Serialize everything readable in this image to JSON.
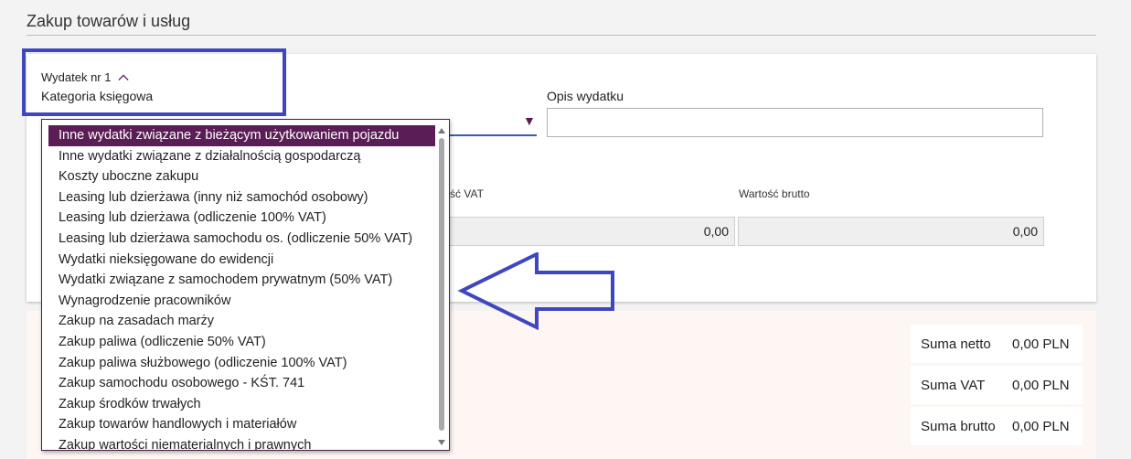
{
  "page": {
    "title": "Zakup towarów i usług"
  },
  "expense": {
    "header": "Wydatek nr 1",
    "category_label": "Kategoria księgowa",
    "description_label": "Opis wydatku",
    "description_value": ""
  },
  "amounts": {
    "vat_label": "rtość VAT",
    "brutto_label": "Wartość brutto",
    "vat_value": "0,00",
    "brutto_value": "0,00"
  },
  "dropdown": {
    "options": [
      "Inne wydatki związane z bieżącym użytkowaniem pojazdu",
      "Inne wydatki związane z działalnością gospodarczą",
      "Koszty uboczne zakupu",
      "Leasing lub dzierżawa (inny niż samochód osobowy)",
      "Leasing lub dzierżawa (odliczenie 100% VAT)",
      "Leasing lub dzierżawa samochodu os. (odliczenie 50% VAT)",
      "Wydatki nieksięgowane do ewidencji",
      "Wydatki związane z samochodem prywatnym (50% VAT)",
      "Wynagrodzenie pracowników",
      "Zakup na zasadach marży",
      "Zakup paliwa (odliczenie 50% VAT)",
      "Zakup paliwa służbowego (odliczenie 100% VAT)",
      "Zakup samochodu osobowego - KŚT. 741",
      "Zakup środków trwałych",
      "Zakup towarów handlowych i materiałów",
      "Zakup wartości niematerialnych i prawnych"
    ],
    "selected_index": 0
  },
  "summary": {
    "netto_label": "Suma netto",
    "netto_value": "0,00 PLN",
    "vat_label": "Suma VAT",
    "vat_value": "0,00 PLN",
    "brutto_label": "Suma brutto",
    "brutto_value": "0,00 PLN"
  },
  "colors": {
    "selected_bg": "#5b1d55",
    "annotation": "#3e46c0",
    "select_underline": "#3a5cae",
    "summary_bg": "#fdf6f2"
  },
  "icons": {
    "collapse": "chevron-up-icon",
    "select": "caret-down-icon",
    "annotation": "left-arrow-icon"
  }
}
